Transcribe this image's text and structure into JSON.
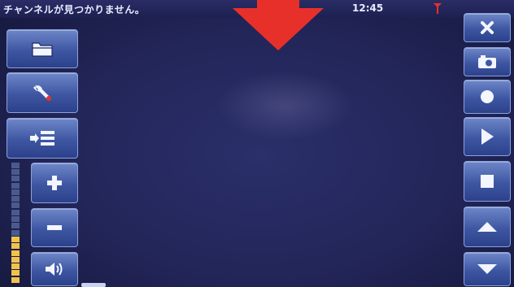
{
  "status_bar": {
    "message": "チャンネルが見つかりません。",
    "time": "12:45"
  },
  "icons": {
    "signal": "antenna-signal-icon",
    "top_indicator": "down-arrow-icon",
    "left_toolbar": [
      "folder-icon",
      "wrench-icon",
      "input-source-icon",
      "plus-icon",
      "minus-icon",
      "speaker-icon"
    ],
    "right_toolbar": [
      "close-icon",
      "camera-icon",
      "record-icon",
      "play-icon",
      "stop-icon",
      "up-arrow-icon",
      "down-arrow-icon"
    ]
  },
  "volume": {
    "level_fraction": 0.4
  },
  "colors": {
    "accent_red": "#e8302a",
    "button_blue": "#4a63ad",
    "volume_lit": "#f2c34a",
    "volume_unlit": "#4b5a8c"
  }
}
